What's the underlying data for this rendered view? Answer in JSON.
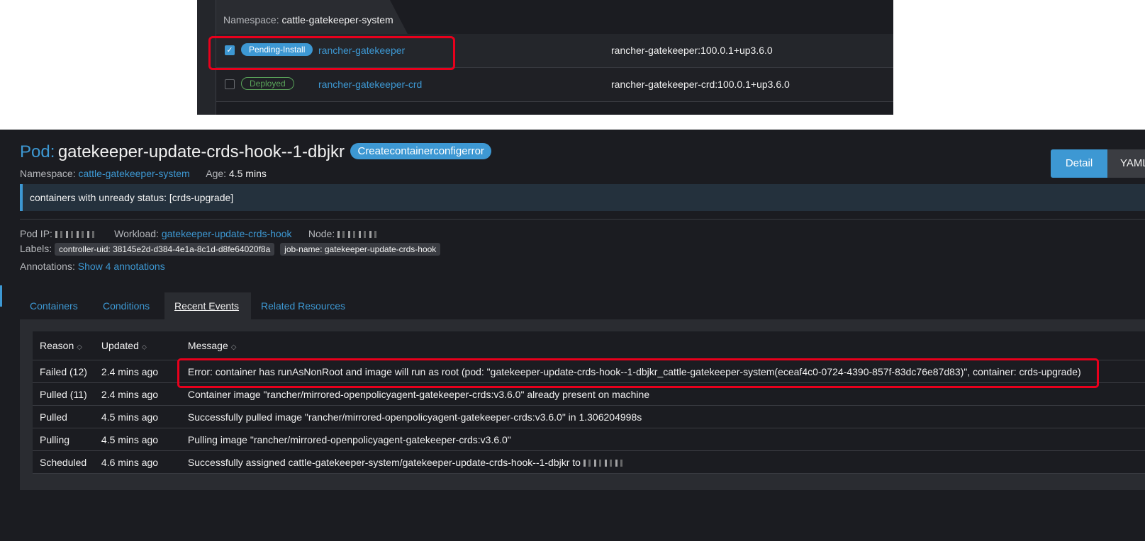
{
  "top": {
    "namespace_label": "Namespace:",
    "namespace_value": "cattle-gatekeeper-system",
    "releases": [
      {
        "checked": true,
        "state": "Pending-Install",
        "name": "rancher-gatekeeper",
        "chart": "rancher-gatekeeper:100.0.1+up3.6.0"
      },
      {
        "checked": false,
        "state": "Deployed",
        "name": "rancher-gatekeeper-crd",
        "chart": "rancher-gatekeeper-crd:100.0.1+up3.6.0"
      }
    ]
  },
  "pod": {
    "title_prefix": "Pod:",
    "title_name": "gatekeeper-update-crds-hook--1-dbjkr",
    "state": "Createcontainerconfigerror",
    "namespace_label": "Namespace:",
    "namespace_value": "cattle-gatekeeper-system",
    "age_label": "Age:",
    "age_value": "4.5 mins",
    "view_detail": "Detail",
    "view_yaml": "YAML",
    "banner": "containers with unready status: [crds-upgrade]",
    "pod_ip_label": "Pod IP:",
    "workload_label": "Workload:",
    "workload_value": "gatekeeper-update-crds-hook",
    "node_label": "Node:",
    "labels_label": "Labels:",
    "labels": [
      "controller-uid: 38145e2d-d384-4e1a-8c1d-d8fe64020f8a",
      "job-name: gatekeeper-update-crds-hook"
    ],
    "annotations_label": "Annotations:",
    "annotations_link": "Show 4 annotations"
  },
  "tabs": [
    "Containers",
    "Conditions",
    "Recent Events",
    "Related Resources"
  ],
  "events": {
    "columns": [
      "Reason",
      "Updated",
      "Message"
    ],
    "rows": [
      {
        "reason": "Failed (12)",
        "updated": "2.4 mins ago",
        "message": "Error: container has runAsNonRoot and image will run as root (pod: \"gatekeeper-update-crds-hook--1-dbjkr_cattle-gatekeeper-system(eceaf4c0-0724-4390-857f-83dc76e87d83)\", container: crds-upgrade)"
      },
      {
        "reason": "Pulled (11)",
        "updated": "2.4 mins ago",
        "message": "Container image \"rancher/mirrored-openpolicyagent-gatekeeper-crds:v3.6.0\" already present on machine"
      },
      {
        "reason": "Pulled",
        "updated": "4.5 mins ago",
        "message": "Successfully pulled image \"rancher/mirrored-openpolicyagent-gatekeeper-crds:v3.6.0\" in 1.306204998s"
      },
      {
        "reason": "Pulling",
        "updated": "4.5 mins ago",
        "message": "Pulling image \"rancher/mirrored-openpolicyagent-gatekeeper-crds:v3.6.0\""
      },
      {
        "reason": "Scheduled",
        "updated": "4.6 mins ago",
        "message": "Successfully assigned cattle-gatekeeper-system/gatekeeper-update-crds-hook--1-dbjkr to"
      }
    ]
  },
  "colors": {
    "accent": "#3d98d3",
    "highlight": "#e8001c",
    "deployed": "#5aa45a"
  }
}
